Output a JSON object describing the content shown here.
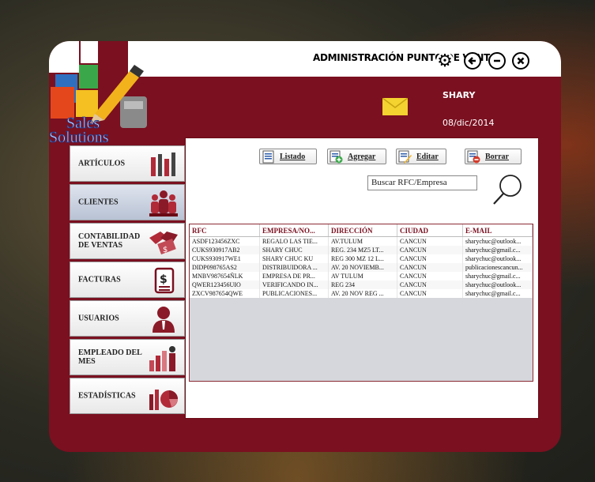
{
  "window": {
    "title": "ADMINISTRACIÓN PUNTO DE VENTA",
    "logo_line1": "Sales",
    "logo_line2": "Solutions"
  },
  "header": {
    "user": "SHARY",
    "date": "08/dic/2014"
  },
  "sidebar": {
    "items": [
      {
        "label": "ARTÍCULOS",
        "icon": "tools-icon"
      },
      {
        "label": "CLIENTES",
        "icon": "people-icon",
        "active": true
      },
      {
        "label": "CONTABILIDAD DE VENTAS",
        "icon": "handshake-money-icon"
      },
      {
        "label": "FACTURAS",
        "icon": "invoice-icon"
      },
      {
        "label": "USUARIOS",
        "icon": "user-icon"
      },
      {
        "label": "EMPLEADO DEL MES",
        "icon": "employee-chart-icon"
      },
      {
        "label": "ESTADÍSTICAS",
        "icon": "statistics-icon"
      }
    ]
  },
  "toolbar": {
    "listado": "Listado",
    "agregar": "Agregar",
    "editar": "Editar",
    "borrar": "Borrar"
  },
  "search": {
    "value": "Buscar RFC/Empresa"
  },
  "table": {
    "headers": [
      "RFC",
      "EMPRESA/NO...",
      "DIRECCIÓN",
      "CIUDAD",
      "E-MAIL"
    ],
    "rows": [
      [
        "ASDF123456ZXC",
        "REGALO LAS TIE...",
        "AV.TULUM",
        "CANCUN",
        "sharychuc@outlook..."
      ],
      [
        "CUKS930917AB2",
        "SHARY CHUC",
        "REG. 234 MZ5 LT...",
        "CANCUN",
        "sharychuc@gmail.c..."
      ],
      [
        "CUKS930917WE1",
        "SHARY CHUC KU",
        "REG 300 MZ 12 L...",
        "CANCUN",
        "sharychuc@outlook..."
      ],
      [
        "DIDP098765AS2",
        "DISTRIBUIDORA ...",
        "AV. 20 NOVIEMB...",
        "CANCUN",
        "publicacionescancun..."
      ],
      [
        "MNBV987654ÑLK",
        "EMPRESA DE PR...",
        "AV TULUM",
        "CANCUN",
        "sharychuc@gmail.c..."
      ],
      [
        "QWER123456UIO",
        "VERIFICANDO IN...",
        "REG 234",
        "CANCUN",
        "sharychuc@outlook..."
      ],
      [
        "ZXCV987654QWE",
        "PUBLICACIONES...",
        "AV. 20 NOV REG ...",
        "CANCUN",
        "sharychuc@gmail.c..."
      ]
    ]
  },
  "colors": {
    "window": "#7a1020",
    "header_text": "#7a1020",
    "table_bg": "#d6d7dc"
  }
}
